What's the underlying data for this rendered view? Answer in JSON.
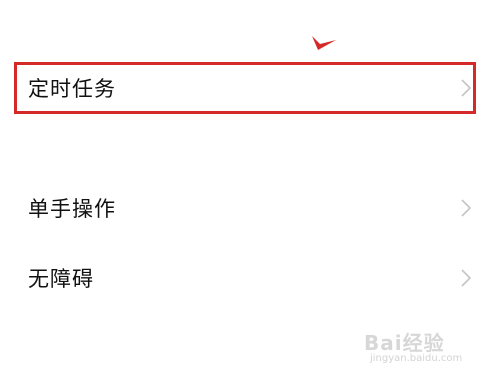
{
  "settings_list": {
    "items": [
      {
        "label": "定时任务",
        "icon": "chevron-right-icon"
      },
      {
        "label": "单手操作",
        "icon": "chevron-right-icon"
      },
      {
        "label": "无障碍",
        "icon": "chevron-right-icon"
      }
    ]
  },
  "annotation": {
    "highlight_color": "#d42a2a",
    "highlighted_item": "定时任务"
  },
  "watermark": {
    "brand": "Bai经验",
    "url": "jingyan.baidu.com"
  },
  "colors": {
    "background": "#ffffff",
    "text": "#111111",
    "chevron": "#c4c4c4"
  }
}
